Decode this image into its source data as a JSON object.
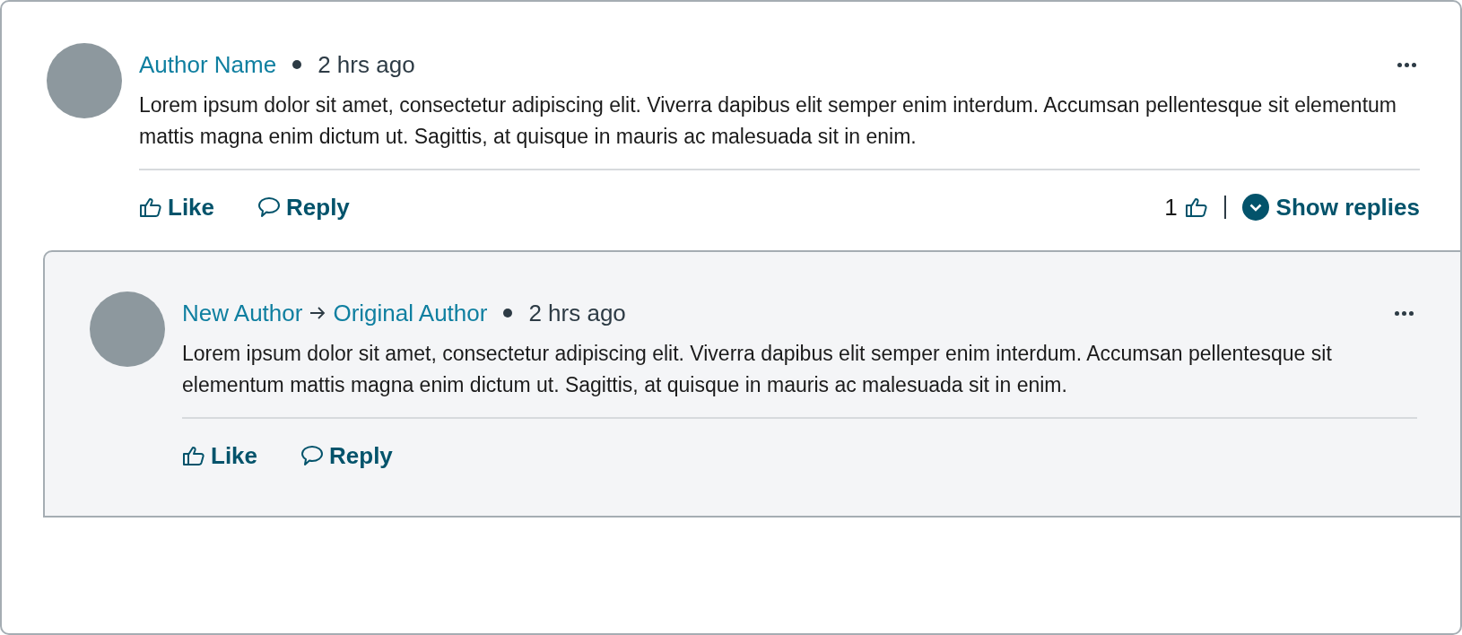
{
  "comments": [
    {
      "author": "Author Name",
      "time": "2 hrs ago",
      "body": "Lorem ipsum dolor sit amet, consectetur adipiscing elit. Viverra dapibus elit semper enim interdum. Accumsan pellentesque sit elementum mattis magna enim dictum ut. Sagittis, at quisque in mauris ac malesuada sit in enim.",
      "actions": [
        "Like",
        "Reply"
      ],
      "like_count": "1",
      "show_replies": "Show replies"
    },
    {
      "author": "New Author",
      "recipient": "Original Author",
      "time": "2 hrs ago",
      "body": "Lorem ipsum dolor sit amet, consectetur adipiscing elit. Viverra dapibus elit semper enim interdum. Accumsan pellentesque sit elementum mattis magna enim dictum ut. Sagittis, at quisque in mauris ac malesuada sit in enim.",
      "actions": [
        "Like",
        "Reply"
      ]
    }
  ]
}
